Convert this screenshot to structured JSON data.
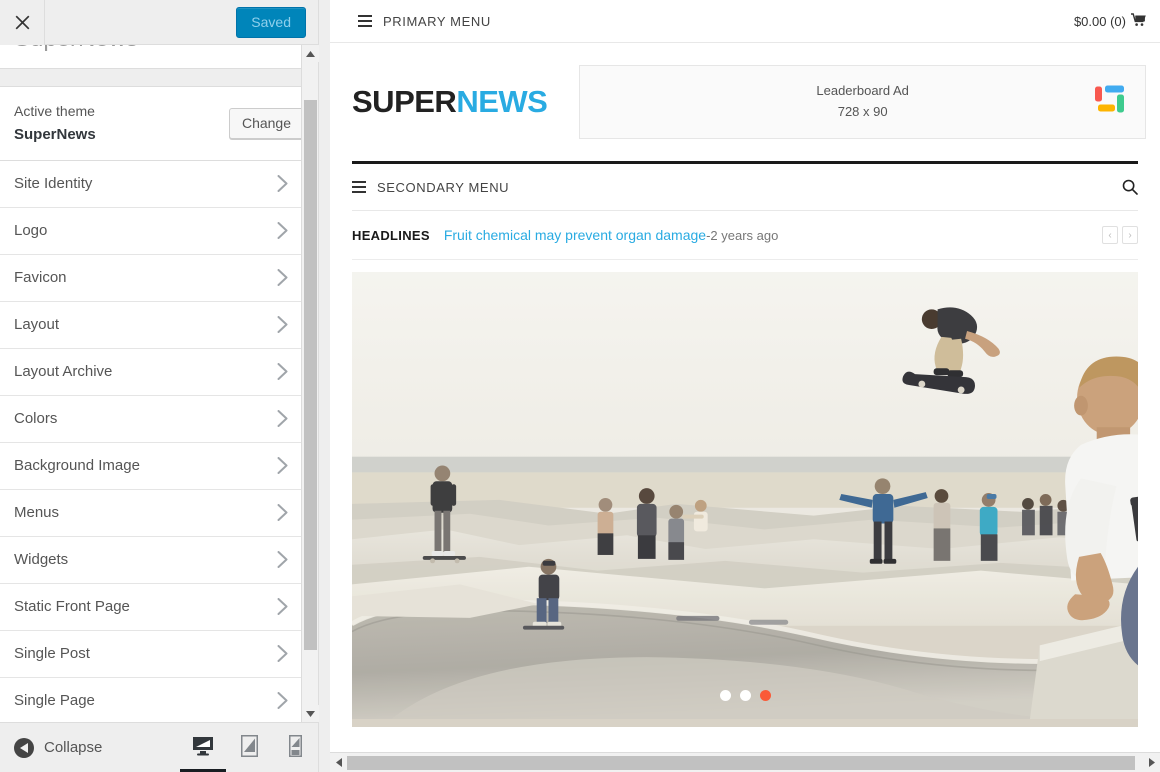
{
  "customizer": {
    "close_icon": "close-x-icon",
    "save_button_label": "Saved",
    "site_title": "SuperNews",
    "theme": {
      "label": "Active theme",
      "name": "SuperNews",
      "change_label": "Change"
    },
    "sections": [
      {
        "label": "Site Identity"
      },
      {
        "label": "Logo"
      },
      {
        "label": "Favicon"
      },
      {
        "label": "Layout"
      },
      {
        "label": "Layout Archive"
      },
      {
        "label": "Colors"
      },
      {
        "label": "Background Image"
      },
      {
        "label": "Menus"
      },
      {
        "label": "Widgets"
      },
      {
        "label": "Static Front Page"
      },
      {
        "label": "Single Post"
      },
      {
        "label": "Single Page"
      }
    ],
    "footer": {
      "collapse_label": "Collapse",
      "devices": [
        {
          "name": "desktop",
          "active": true
        },
        {
          "name": "tablet",
          "active": false
        },
        {
          "name": "mobile",
          "active": false
        }
      ]
    },
    "accent_color": "#0085ba"
  },
  "preview": {
    "primary_menu_label": "PRIMARY MENU",
    "cart_label": "$0.00 (0)",
    "logo": {
      "part1": "SUPER",
      "part2": "NEWS",
      "color1": "#222222",
      "color2": "#29abe2"
    },
    "ad": {
      "title": "Leaderboard Ad",
      "size": "728 x 90"
    },
    "secondary_menu_label": "SECONDARY MENU",
    "headlines": {
      "label": "HEADLINES",
      "post_title": "Fruit chemical may prevent organ damage",
      "separator": " - ",
      "time": "2 years ago",
      "prev": "‹",
      "next": "›",
      "link_color": "#29abe2"
    },
    "slider": {
      "dots": 3,
      "active_index": 2,
      "active_color": "#fa5a37",
      "inactive_color": "#ffffff",
      "image_alt": "Skatepark bowl with skateboarders, one mid-air"
    }
  }
}
